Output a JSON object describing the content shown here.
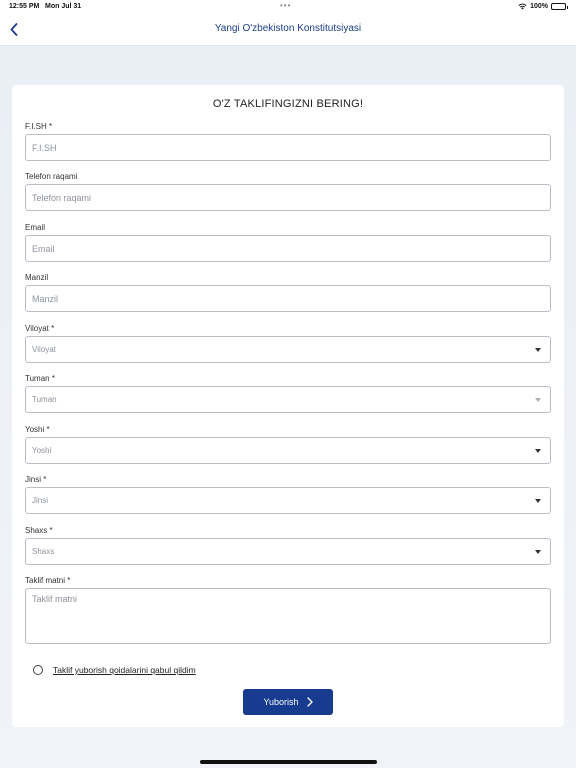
{
  "status_bar": {
    "time": "12:55 PM",
    "date": "Mon Jul 31",
    "dots": "•••",
    "battery_text": "100%",
    "battery_level": 1.0
  },
  "nav": {
    "title": "Yangi O'zbekiston Konstitutsiyasi",
    "back_icon": "chevron-left-icon"
  },
  "form": {
    "title": "O'Z TAKLIFINGIZNI BERING!",
    "fields": [
      {
        "label": "F.I.SH *",
        "placeholder": "F.I.SH"
      },
      {
        "label": "Telefon raqami",
        "placeholder": "Telefon raqami"
      },
      {
        "label": "Email",
        "placeholder": "Email"
      },
      {
        "label": "Manzil",
        "placeholder": "Manzil"
      }
    ],
    "selects": [
      {
        "label": "Viloyat *",
        "placeholder": "Viloyat"
      },
      {
        "label": "Tuman *",
        "placeholder": "Tuman"
      },
      {
        "label": "Yoshi *",
        "placeholder": "Yoshi"
      },
      {
        "label": "Jinsi *",
        "placeholder": "Jinsi"
      },
      {
        "label": "Shaxs *",
        "placeholder": "Shaxs"
      }
    ],
    "textarea": {
      "label": "Taklif matni *",
      "placeholder": "Taklif matni"
    },
    "agree_text": "Taklif yuborish qoidalarini qabul qildim",
    "submit_label": "Yuborish"
  },
  "colors": {
    "accent": "#163b8f",
    "nav_title": "#1d3f86"
  }
}
